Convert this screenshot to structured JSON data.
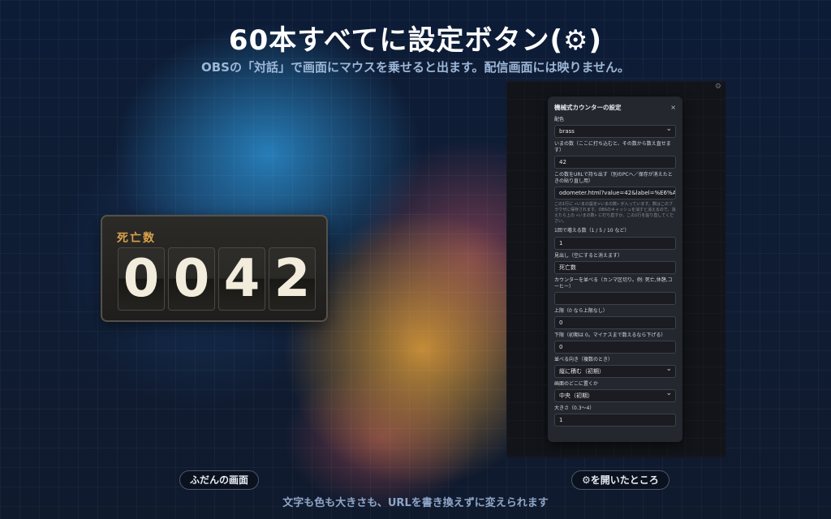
{
  "header": {
    "title": "60本すべてに設定ボタン(⚙)",
    "subtitle": "OBSの「対話」で画面にマウスを乗せると出ます。配信画面には映りません。"
  },
  "counter": {
    "label": "死亡数",
    "digits": [
      "0",
      "0",
      "4",
      "2"
    ]
  },
  "preview": {
    "corner_icon": "⚙",
    "dialog": {
      "title": "機械式カウンターの設定",
      "close": "×",
      "fields": [
        {
          "label": "配色",
          "value": "brass",
          "type": "select"
        },
        {
          "label": "いまの数（ここに打ち込むと、その数から数え直せます）",
          "value": "42",
          "type": "input"
        },
        {
          "label": "この数をURLで持ち出す（別のPCへ／保存が消えたときの貼り直し用）",
          "value": "odometer.html?value=42&label=%E6%AD",
          "type": "input",
          "hint": "この1行に «いまの設定+いまの数» が入っています。数はこのブラウザに保存されます。OBSのキャッシュを消すと消えるので、消えたら上の «いまの数» に打ち直すか、この1行を貼り直してください。"
        },
        {
          "label": "1回で増える数（1 / 5 / 10 など）",
          "value": "1",
          "type": "input"
        },
        {
          "label": "見出し（空にすると消えます）",
          "value": "死亡数",
          "type": "input"
        },
        {
          "label": "カウンターを並べる（カンマ区切り。例: 死亡,休憩,コーヒー）",
          "value": "",
          "type": "input"
        },
        {
          "label": "上限（0 なら上限なし）",
          "value": "0",
          "type": "input"
        },
        {
          "label": "下限（初期は 0。マイナスまで数えるなら下げる）",
          "value": "0",
          "type": "input"
        },
        {
          "label": "並べる向き（複数のとき）",
          "value": "縦に積む（初期）",
          "type": "select"
        },
        {
          "label": "画面のどこに置くか",
          "value": "中央（初期）",
          "type": "select"
        },
        {
          "label": "大きさ（0.3〜4）",
          "value": "1",
          "type": "input"
        }
      ]
    }
  },
  "captions": {
    "left": "ふだんの画面",
    "right": "⚙を開いたところ"
  },
  "footer": "文字も色も大きさも、URLを書き換えずに変えられます",
  "colors": {
    "label_accent": "#d9a24a",
    "digit_text": "#f2ecdc",
    "subtitle": "#9db6d6"
  }
}
